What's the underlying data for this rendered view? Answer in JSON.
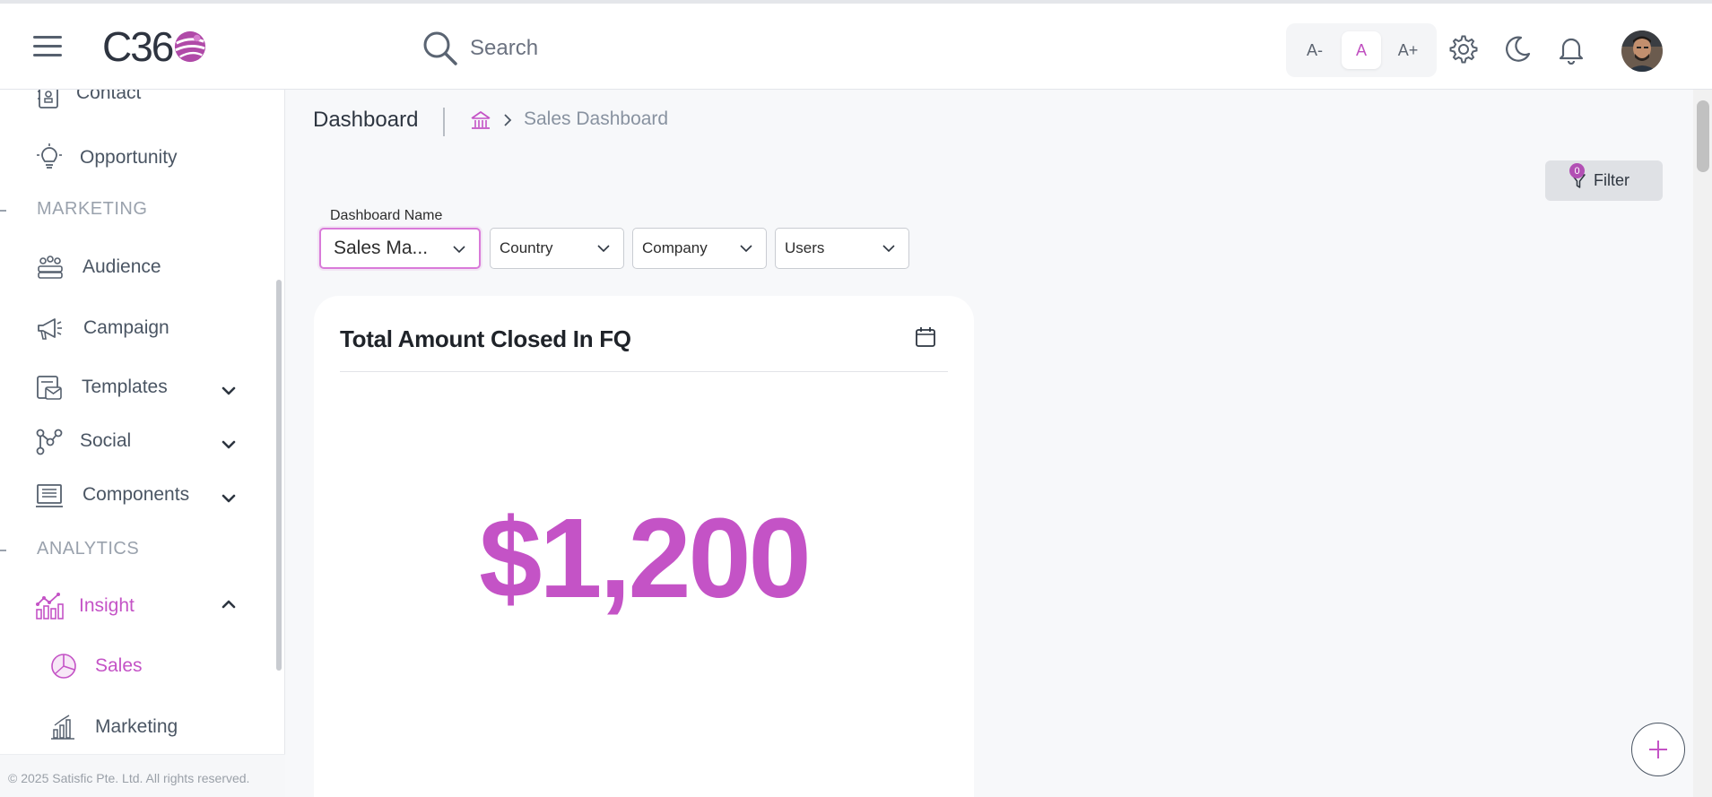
{
  "header": {
    "logo_text": "C36",
    "search_placeholder": "Search",
    "font_sizes": [
      "A-",
      "A",
      "A+"
    ],
    "icons": [
      "menu-icon",
      "search-icon",
      "settings-icon",
      "moon-icon",
      "bell-icon"
    ]
  },
  "sidebar": {
    "items": [
      {
        "label": "Contact",
        "icon": "contact-icon"
      },
      {
        "label": "Opportunity",
        "icon": "lightbulb-icon"
      },
      {
        "label": "Audience",
        "icon": "audience-icon"
      },
      {
        "label": "Campaign",
        "icon": "megaphone-icon"
      },
      {
        "label": "Templates",
        "icon": "templates-icon"
      },
      {
        "label": "Social",
        "icon": "social-icon"
      },
      {
        "label": "Components",
        "icon": "components-icon"
      },
      {
        "label": "Insight",
        "icon": "insight-icon"
      },
      {
        "label": "Sales",
        "icon": "pie-icon"
      },
      {
        "label": "Marketing",
        "icon": "bar-chart-icon"
      }
    ],
    "sections": {
      "marketing": "MARKETING",
      "analytics": "ANALYTICS"
    },
    "copyright": "© 2025 Satisfic Pte. Ltd. All rights reserved."
  },
  "main": {
    "title": "Dashboard",
    "breadcrumb_current": "Sales Dashboard",
    "filter_label": "Filter",
    "filter_count": "0",
    "dashboard_name_label": "Dashboard Name",
    "selects": {
      "dashboard": "Sales Ma...",
      "country": "Country",
      "company": "Company",
      "users": "Users"
    },
    "card": {
      "title": "Total Amount Closed In FQ",
      "value": "$1,200"
    }
  },
  "colors": {
    "accent": "#c453c6",
    "text_muted": "#9aa2ad",
    "nav_text": "#4a5563"
  }
}
